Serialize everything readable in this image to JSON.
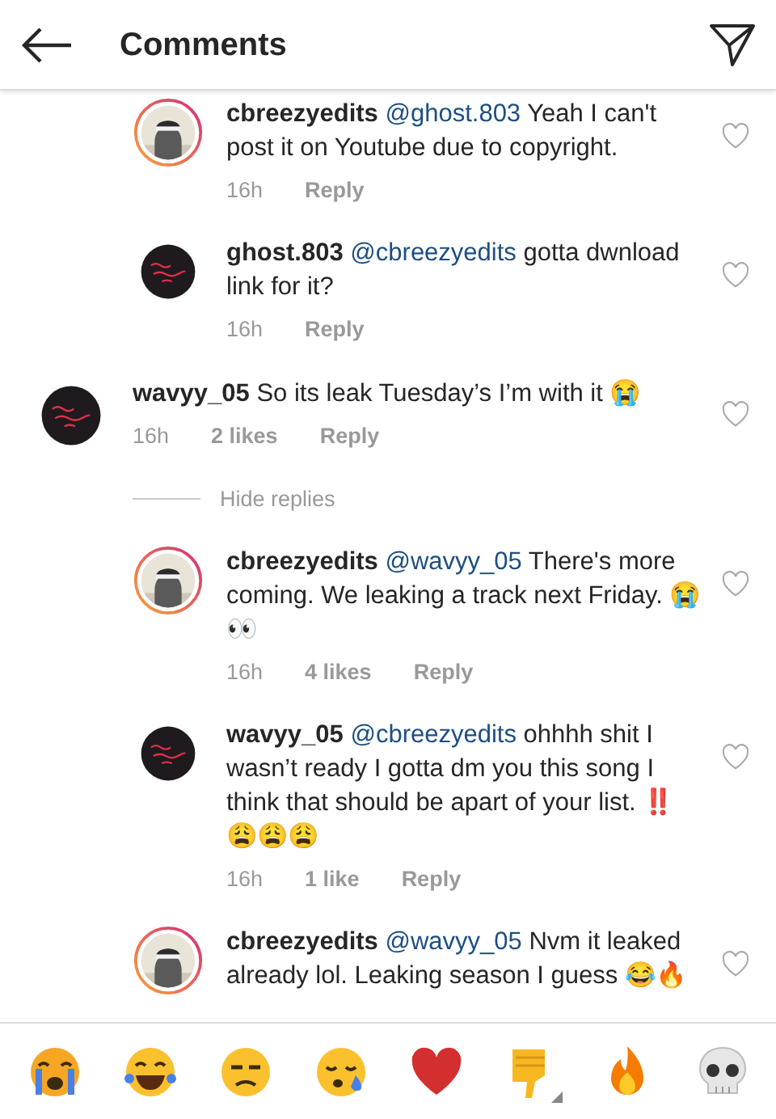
{
  "header": {
    "title": "Comments"
  },
  "earlier_replies": [
    {
      "username": "cbreezyedits",
      "mention": "@ghost.803",
      "text": "Yeah I can't post it on Youtube due to copyright.",
      "time": "16h",
      "reply": "Reply",
      "story_ring": true
    },
    {
      "username": "ghost.803",
      "mention": "@cbreezyedits",
      "text": "gotta dwnload link for it?",
      "time": "16h",
      "reply": "Reply",
      "story_ring": false
    }
  ],
  "comments": [
    {
      "username": "wavyy_05",
      "text": "So its leak Tuesday’s I’m with it 😭",
      "time": "16h",
      "likes": "2 likes",
      "reply": "Reply",
      "story_ring": false,
      "hide_replies": "Hide replies",
      "children": [
        {
          "username": "cbreezyedits",
          "mention": "@wavyy_05",
          "text": "There's more coming. We leaking a track next Friday. 😭 👀",
          "time": "16h",
          "likes": "4 likes",
          "reply": "Reply",
          "story_ring": true
        },
        {
          "username": "wavyy_05",
          "mention": "@cbreezyedits",
          "text": "ohhhh shit I wasn’t ready I gotta dm you this song I think that should be apart of your list.  ‼️ 😩😩😩",
          "time": "16h",
          "likes": "1 like",
          "reply": "Reply",
          "story_ring": false
        },
        {
          "username": "cbreezyedits",
          "mention": "@wavyy_05",
          "text": "Nvm it leaked already lol. Leaking season I guess 😂🔥",
          "story_ring": true
        }
      ]
    }
  ],
  "emoji_bar": [
    {
      "kind": "crying",
      "variants": false
    },
    {
      "kind": "laughing",
      "variants": false
    },
    {
      "kind": "unamused",
      "variants": false
    },
    {
      "kind": "sleepy",
      "variants": false
    },
    {
      "kind": "heart",
      "variants": false
    },
    {
      "kind": "thumbs_down",
      "variants": true
    },
    {
      "kind": "fire",
      "variants": false
    },
    {
      "kind": "skull",
      "variants": false
    }
  ]
}
